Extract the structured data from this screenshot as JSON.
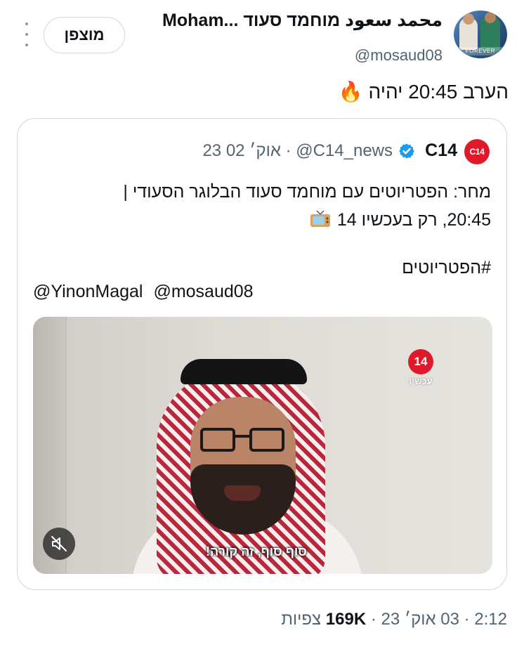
{
  "author": {
    "display_name": "Moham... محمد سعود מוחמד סעוד",
    "handle": "@mosaud08",
    "avatar_banner_text": "FOREVER",
    "follow_label": "מוצפן"
  },
  "tweet": {
    "text": "הערב 20:45 יהיה 🔥"
  },
  "quote": {
    "avatar_text": "C14",
    "name": "C14",
    "meta": "23 אוק׳ 02 · @C14_news",
    "body_line1": "מחר: הפטריוטים עם מוחמד סעוד הבלוגר הסעודי |",
    "body_line2_a": "20:45, רק בעכשיו 14",
    "hashtag": "#הפטריוטים",
    "mention1": "@YinonMagal",
    "mention2": "@mosaud08",
    "media": {
      "channel_logo": "14",
      "channel_sub": "עכשיו",
      "subtitle": "סוף סוף, זה קורה!"
    }
  },
  "footer": {
    "time": "2:12",
    "date": "03 אוק׳ 23",
    "views": "169K",
    "views_label": "צפיות"
  },
  "colors": {
    "text": "#0f1419",
    "secondary": "#536471",
    "border": "#cfd9de",
    "verified": "#1d9bf0",
    "brand_red": "#e0192a"
  },
  "icons": [
    "more-icon",
    "verified-icon",
    "tv-icon",
    "fire-emoji",
    "mute-icon"
  ]
}
